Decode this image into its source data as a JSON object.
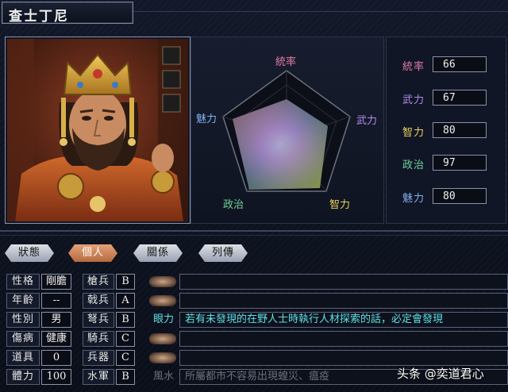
{
  "window": {
    "title": "查士丁尼"
  },
  "radar": {
    "labels": {
      "top": "統率",
      "right": "武力",
      "bottom_right": "智力",
      "bottom_left": "政治",
      "left": "魅力"
    },
    "label_colors": {
      "top": "#e27ba6",
      "right": "#b08cf0",
      "bottom_right": "#e8d05c",
      "bottom_left": "#6fd49c",
      "left": "#7fb0ef"
    }
  },
  "stats": [
    {
      "label": "統率",
      "value": "66",
      "color": "#e27ba6"
    },
    {
      "label": "武力",
      "value": "67",
      "color": "#b08cf0"
    },
    {
      "label": "智力",
      "value": "80",
      "color": "#e8d05c"
    },
    {
      "label": "政治",
      "value": "97",
      "color": "#6fd49c"
    },
    {
      "label": "魅力",
      "value": "80",
      "color": "#7fb0ef"
    }
  ],
  "tabs": [
    {
      "label": "狀態",
      "active": false
    },
    {
      "label": "個人",
      "active": true
    },
    {
      "label": "關係",
      "active": false
    },
    {
      "label": "列傳",
      "active": false
    }
  ],
  "personal": [
    {
      "label": "性格",
      "value": "剛膽"
    },
    {
      "label": "年齡",
      "value": "--"
    },
    {
      "label": "性別",
      "value": "男"
    },
    {
      "label": "傷病",
      "value": "健康"
    },
    {
      "label": "道具",
      "value": "0"
    },
    {
      "label": "體力",
      "value": "100"
    }
  ],
  "aptitudes": [
    {
      "label": "槍兵",
      "grade": "B"
    },
    {
      "label": "戟兵",
      "grade": "A"
    },
    {
      "label": "弩兵",
      "grade": "B"
    },
    {
      "label": "騎兵",
      "grade": "C"
    },
    {
      "label": "兵器",
      "grade": "C"
    },
    {
      "label": "水軍",
      "grade": "B"
    }
  ],
  "skills": [
    {
      "name": "",
      "desc": ""
    },
    {
      "name": "",
      "desc": ""
    },
    {
      "name": "眼力",
      "desc": "若有未發現的在野人士時執行人材探索的話，必定會發現",
      "color": "#5de0e6"
    },
    {
      "name": "",
      "desc": ""
    },
    {
      "name": "",
      "desc": ""
    },
    {
      "name": "風水",
      "desc": "所屬都市不容易出現蝗災、瘟疫",
      "color": "#6b6f7a"
    }
  ],
  "watermark": "头条 @奕道君心"
}
